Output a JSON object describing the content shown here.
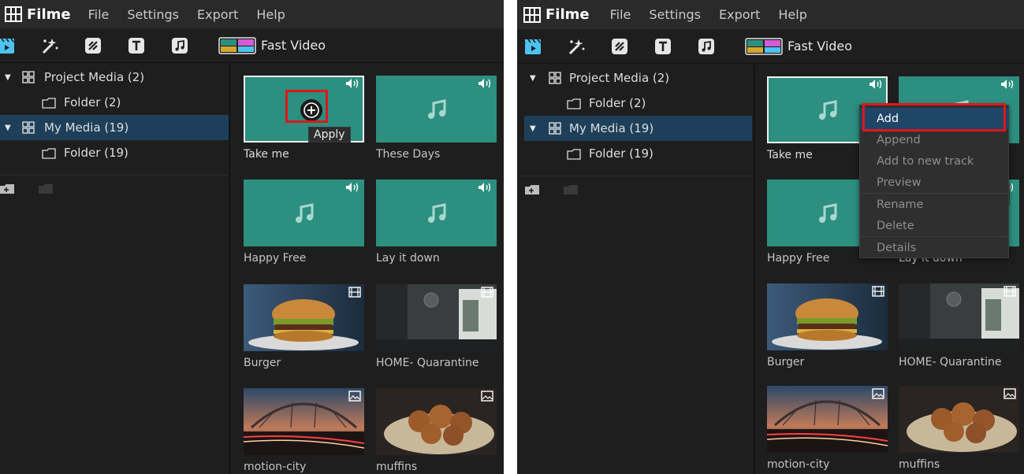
{
  "app": {
    "name": "Filme"
  },
  "menu": [
    "File",
    "Settings",
    "Export",
    "Help"
  ],
  "toolbar": {
    "tools": [
      "media-icon",
      "effects-icon",
      "transitions-icon",
      "text-icon",
      "music-icon"
    ],
    "fast_video_label": "Fast Video"
  },
  "sidebar": {
    "items": [
      {
        "label": "Project Media (2)",
        "type": "group",
        "expanded": true
      },
      {
        "label": "Folder (2)",
        "type": "folder"
      },
      {
        "label": "My Media (19)",
        "type": "group",
        "expanded": true,
        "selected": true
      },
      {
        "label": "Folder (19)",
        "type": "folder"
      }
    ],
    "buttons": [
      "add-folder-icon",
      "delete-folder-icon"
    ]
  },
  "media": [
    {
      "label": "Take me",
      "kind": "audio"
    },
    {
      "label": "These Days",
      "kind": "audio"
    },
    {
      "label": "Happy Free",
      "kind": "audio"
    },
    {
      "label": "Lay it down",
      "kind": "audio"
    },
    {
      "label": "Burger",
      "kind": "video"
    },
    {
      "label": "HOME- Quarantine",
      "kind": "video"
    },
    {
      "label": "motion-city",
      "kind": "image"
    },
    {
      "label": "muffins",
      "kind": "image"
    }
  ],
  "left_panel": {
    "tooltip": "Apply"
  },
  "context_menu": {
    "items": [
      "Add",
      "Append",
      "Add to new track",
      "Preview",
      "Rename",
      "Delete",
      "Details"
    ],
    "active": "Add"
  },
  "colors": {
    "audio_tile": "#2c8f7f",
    "selected_row": "#1e3f59",
    "highlight": "#e0161b",
    "accent": "#4cc3f0"
  }
}
